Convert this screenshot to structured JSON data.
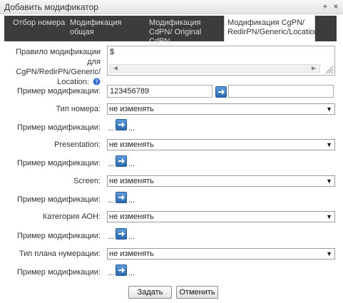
{
  "window": {
    "title": "Добавить модификатор",
    "pin_label": "+",
    "close_label": "×"
  },
  "tabs": [
    {
      "label": "Отбор номера"
    },
    {
      "label": "Модификация общая"
    },
    {
      "label": "Модификация CdPN/ Original CdPN"
    },
    {
      "label": "Модификация CgPN/ RedirPN/Generic/Location"
    }
  ],
  "rule": {
    "label": "Правило модификации для CgPN/RedirPN/Generic/ Location:",
    "value": "$"
  },
  "example1": {
    "label": "Пример модификации:",
    "input_value": "123456789",
    "output_value": ""
  },
  "fields": [
    {
      "label": "Тип номера:",
      "value": "не изменять",
      "example_label": "Пример модификации:",
      "example_in": "...",
      "example_out": "..."
    },
    {
      "label": "Presentation:",
      "value": "не изменять",
      "example_label": "Пример модификации:",
      "example_in": "...",
      "example_out": "..."
    },
    {
      "label": "Screen:",
      "value": "не изменять",
      "example_label": "Пример модификации:",
      "example_in": "...",
      "example_out": "..."
    },
    {
      "label": "Категория АОН:",
      "value": "не изменять",
      "example_label": "Пример модификации:",
      "example_in": "...",
      "example_out": "..."
    },
    {
      "label": "Тип плана нумерации:",
      "value": "не изменять",
      "example_label": "Пример модификации:",
      "example_in": "...",
      "example_out": "..."
    }
  ],
  "buttons": {
    "submit": "Задать",
    "cancel": "Отменить"
  },
  "icons": {
    "help": "help-icon",
    "go": "arrow-right-icon"
  },
  "colors": {
    "tab_bar": "#3c3c3c",
    "go_button": "#2a69b0",
    "help": "#3b6fd0"
  }
}
